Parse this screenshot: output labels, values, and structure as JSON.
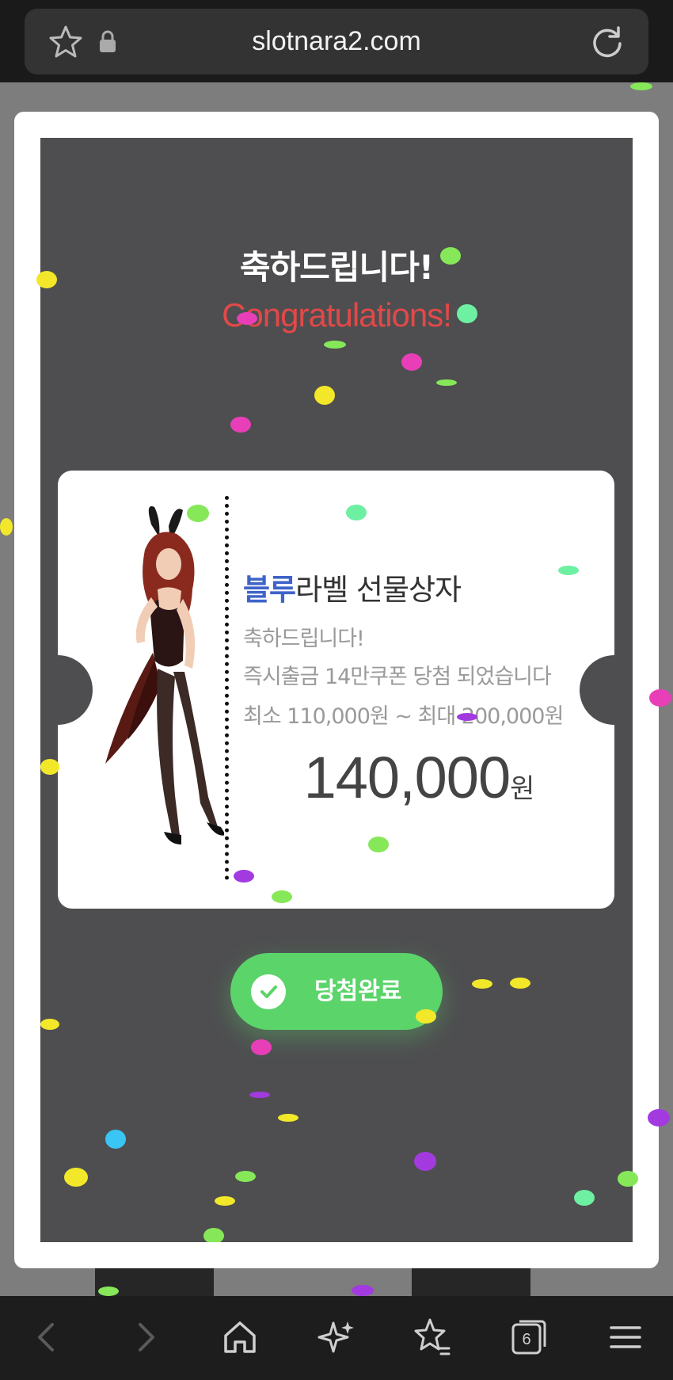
{
  "browser": {
    "url": "slotnara2.com",
    "tab_count": "6",
    "icons": [
      "star-icon",
      "lock-icon",
      "reload-icon",
      "back-icon",
      "forward-icon",
      "home-icon",
      "sparkle-icon",
      "favorites-icon",
      "tabs-icon",
      "menu-icon"
    ]
  },
  "modal": {
    "title_ko": "축하드립니다!",
    "title_en": "Congratulations!",
    "ticket": {
      "prize_title_highlight": "블루",
      "prize_title_rest": "라벨 선물상자",
      "line1": "축하드립니다!",
      "line2": "즉시출금 14만쿠폰 당첨 되었습니다",
      "line3": "최소 110,000원 ~ 최대 200,000원",
      "amount": "140,000",
      "amount_unit": "원"
    },
    "done_button": "당첨완료"
  },
  "colors": {
    "modal_bg": "#4e4e50",
    "title_en": "#e34848",
    "highlight_blue": "#3e63c9",
    "button_green": "#5bd46a"
  }
}
